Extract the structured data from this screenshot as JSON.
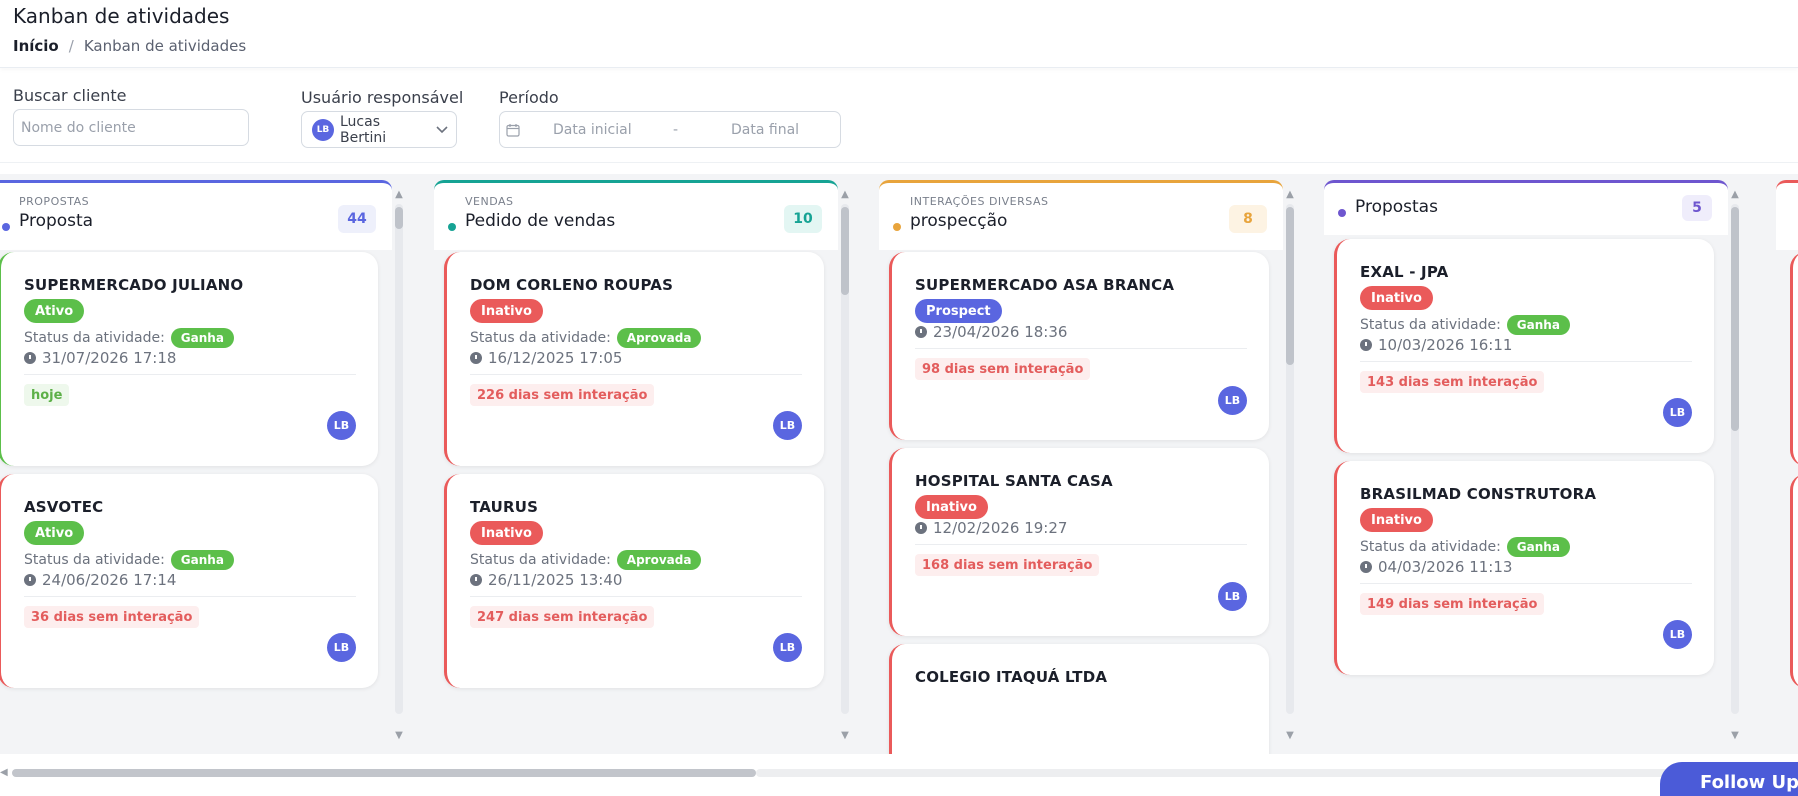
{
  "header": {
    "title": "Kanban de atividades",
    "breadcrumb_home": "Início",
    "breadcrumb_sep": "/",
    "breadcrumb_current": "Kanban de atividades"
  },
  "filters": {
    "client_label": "Buscar cliente",
    "client_placeholder": "Nome do cliente",
    "user_label": "Usuário responsável",
    "user_initials": "LB",
    "user_name": "Lucas Bertini",
    "period_label": "Período",
    "start_placeholder": "Data inicial",
    "period_sep": "-",
    "end_placeholder": "Data final"
  },
  "colors": {
    "accent": "#5a66e0",
    "red": "#ea5a5a",
    "green": "#5cbf4a",
    "teal": "#16a394",
    "orange": "#e8a43c",
    "purple": "#6e56cf",
    "prospect": "#5a66e0"
  },
  "columns": [
    {
      "category": "PROPOSTAS",
      "title": "Proposta",
      "count": "44",
      "cards": [
        {
          "name": "SUPERMERCADO JULIANO",
          "badge": "Ativo",
          "status_label": "Status da atividade:",
          "status": "Ganha",
          "date": "31/07/2026 17:18",
          "tag": "hoje",
          "avatar": "LB"
        },
        {
          "name": "ASVOTEC",
          "badge": "Ativo",
          "status_label": "Status da atividade:",
          "status": "Ganha",
          "date": "24/06/2026 17:14",
          "tag": "36 dias sem interação",
          "avatar": "LB"
        }
      ]
    },
    {
      "category": "VENDAS",
      "title": "Pedido de vendas",
      "count": "10",
      "cards": [
        {
          "name": "DOM CORLENO ROUPAS",
          "badge": "Inativo",
          "status_label": "Status da atividade:",
          "status": "Aprovada",
          "date": "16/12/2025 17:05",
          "tag": "226 dias sem interação",
          "avatar": "LB"
        },
        {
          "name": "TAURUS",
          "badge": "Inativo",
          "status_label": "Status da atividade:",
          "status": "Aprovada",
          "date": "26/11/2025 13:40",
          "tag": "247 dias sem interação",
          "avatar": "LB"
        }
      ]
    },
    {
      "category": "INTERAÇÕES DIVERSAS",
      "title": "prospecção",
      "count": "8",
      "cards": [
        {
          "name": "SUPERMERCADO ASA BRANCA",
          "badge": "Prospect",
          "date": "23/04/2026 18:36",
          "tag": "98 dias sem interação",
          "avatar": "LB"
        },
        {
          "name": "HOSPITAL SANTA CASA",
          "badge": "Inativo",
          "date": "12/02/2026 19:27",
          "tag": "168 dias sem interação",
          "avatar": "LB"
        },
        {
          "name": "COLEGIO ITAQUÁ LTDA"
        }
      ]
    },
    {
      "title": "Propostas",
      "count": "5",
      "cards": [
        {
          "name": "EXAL - JPA",
          "badge": "Inativo",
          "status_label": "Status da atividade:",
          "status": "Ganha",
          "date": "10/03/2026 16:11",
          "tag": "143 dias sem interação",
          "avatar": "LB"
        },
        {
          "name": "BRASILMAD CONSTRUTORA",
          "badge": "Inativo",
          "status_label": "Status da atividade:",
          "status": "Ganha",
          "date": "04/03/2026 11:13",
          "tag": "149 dias sem interação",
          "avatar": "LB"
        }
      ]
    }
  ],
  "follow_ups": "Follow Ups"
}
